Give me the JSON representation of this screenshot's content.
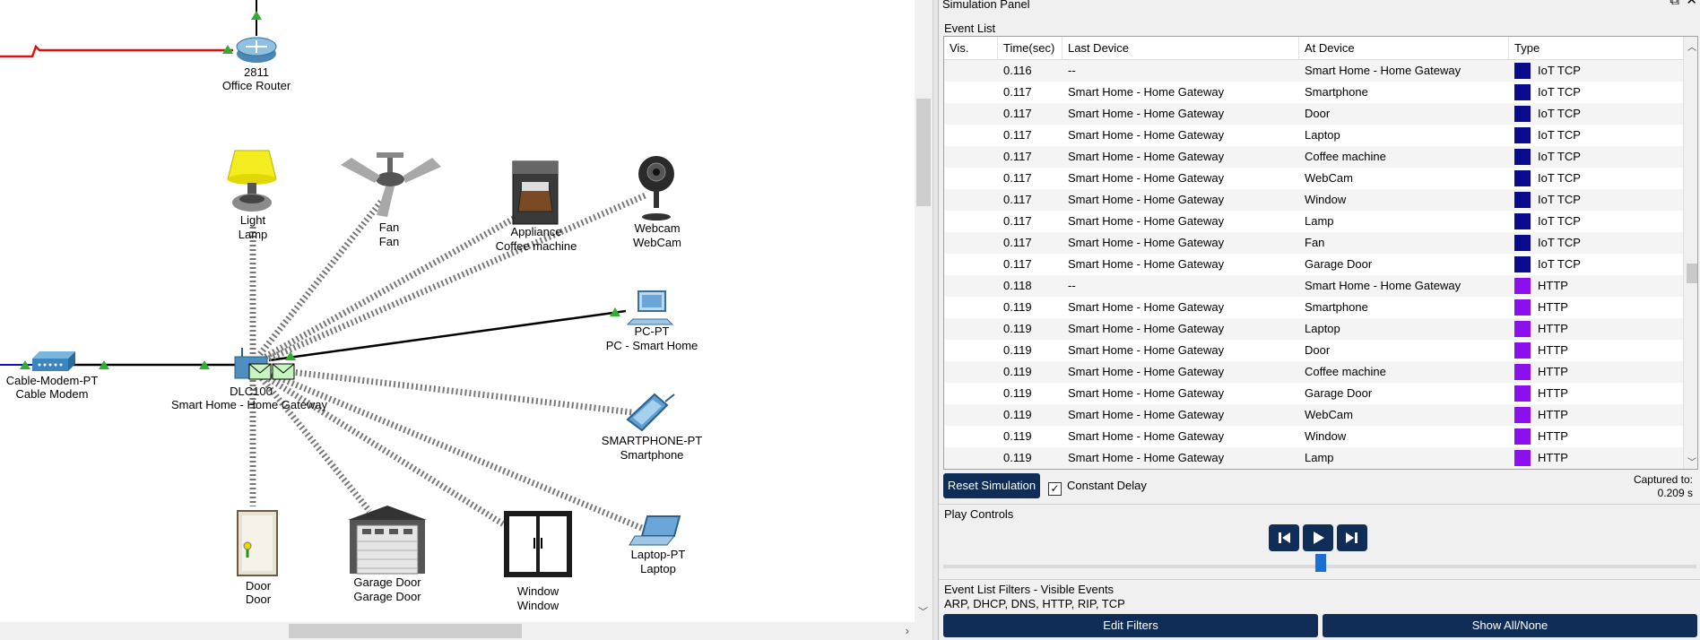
{
  "devices": {
    "office_router": {
      "model": "2811",
      "name": "Office Router"
    },
    "cable_modem": {
      "model": "Cable-Modem-PT",
      "name": "Cable Modem"
    },
    "home_gateway": {
      "model": "DLC100",
      "name": "Smart Home - Home Gateway"
    },
    "lamp": {
      "model": "Light",
      "name": "Lamp"
    },
    "fan": {
      "model": "Fan",
      "name": "Fan"
    },
    "coffee": {
      "model": "Appliance",
      "name": "Coffee machine"
    },
    "webcam": {
      "model": "Webcam",
      "name": "WebCam"
    },
    "pc": {
      "model": "PC-PT",
      "name": "PC - Smart Home"
    },
    "smartphone": {
      "model": "SMARTPHONE-PT",
      "name": "Smartphone"
    },
    "laptop": {
      "model": "Laptop-PT",
      "name": "Laptop"
    },
    "door": {
      "model": "Door",
      "name": "Door"
    },
    "garage": {
      "model": "Garage Door",
      "name": "Garage Door"
    },
    "window": {
      "model": "Window",
      "name": "Window"
    }
  },
  "panel": {
    "title": "Simulation Panel",
    "event_list_label": "Event List",
    "columns": [
      "Vis.",
      "Time(sec)",
      "Last Device",
      "At Device",
      "Type"
    ],
    "events": [
      {
        "time": "0.116",
        "last": "--",
        "at": "Smart Home - Home Gateway",
        "type": "IoT TCP",
        "color": "#0a0a8c"
      },
      {
        "time": "0.117",
        "last": "Smart Home - Home Gateway",
        "at": "Smartphone",
        "type": "IoT TCP",
        "color": "#0a0a8c"
      },
      {
        "time": "0.117",
        "last": "Smart Home - Home Gateway",
        "at": "Door",
        "type": "IoT TCP",
        "color": "#0a0a8c"
      },
      {
        "time": "0.117",
        "last": "Smart Home - Home Gateway",
        "at": "Laptop",
        "type": "IoT TCP",
        "color": "#0a0a8c"
      },
      {
        "time": "0.117",
        "last": "Smart Home - Home Gateway",
        "at": "Coffee machine",
        "type": "IoT TCP",
        "color": "#0a0a8c"
      },
      {
        "time": "0.117",
        "last": "Smart Home - Home Gateway",
        "at": "WebCam",
        "type": "IoT TCP",
        "color": "#0a0a8c"
      },
      {
        "time": "0.117",
        "last": "Smart Home - Home Gateway",
        "at": "Window",
        "type": "IoT TCP",
        "color": "#0a0a8c"
      },
      {
        "time": "0.117",
        "last": "Smart Home - Home Gateway",
        "at": "Lamp",
        "type": "IoT TCP",
        "color": "#0a0a8c"
      },
      {
        "time": "0.117",
        "last": "Smart Home - Home Gateway",
        "at": "Fan",
        "type": "IoT TCP",
        "color": "#0a0a8c"
      },
      {
        "time": "0.117",
        "last": "Smart Home - Home Gateway",
        "at": "Garage Door",
        "type": "IoT TCP",
        "color": "#0a0a8c"
      },
      {
        "time": "0.118",
        "last": "--",
        "at": "Smart Home - Home Gateway",
        "type": "HTTP",
        "color": "#8c0ff0"
      },
      {
        "time": "0.119",
        "last": "Smart Home - Home Gateway",
        "at": "Smartphone",
        "type": "HTTP",
        "color": "#8c0ff0"
      },
      {
        "time": "0.119",
        "last": "Smart Home - Home Gateway",
        "at": "Laptop",
        "type": "HTTP",
        "color": "#8c0ff0"
      },
      {
        "time": "0.119",
        "last": "Smart Home - Home Gateway",
        "at": "Door",
        "type": "HTTP",
        "color": "#8c0ff0"
      },
      {
        "time": "0.119",
        "last": "Smart Home - Home Gateway",
        "at": "Coffee machine",
        "type": "HTTP",
        "color": "#8c0ff0"
      },
      {
        "time": "0.119",
        "last": "Smart Home - Home Gateway",
        "at": "Garage Door",
        "type": "HTTP",
        "color": "#8c0ff0"
      },
      {
        "time": "0.119",
        "last": "Smart Home - Home Gateway",
        "at": "WebCam",
        "type": "HTTP",
        "color": "#8c0ff0"
      },
      {
        "time": "0.119",
        "last": "Smart Home - Home Gateway",
        "at": "Window",
        "type": "HTTP",
        "color": "#8c0ff0"
      },
      {
        "time": "0.119",
        "last": "Smart Home - Home Gateway",
        "at": "Lamp",
        "type": "HTTP",
        "color": "#8c0ff0"
      }
    ],
    "reset_label": "Reset Simulation",
    "constant_delay_label": "Constant Delay",
    "constant_delay_checked": true,
    "captured_label": "Captured to:",
    "captured_value": "0.209 s",
    "play_controls_label": "Play Controls",
    "filters_label": "Event List Filters - Visible Events",
    "filters_value": "ARP, DHCP, DNS, HTTP, RIP, TCP",
    "edit_filters_label": "Edit Filters",
    "show_all_label": "Show All/None"
  },
  "colors": {
    "navy_button": "#0f2d56",
    "iot_tcp": "#0a0a8c",
    "http": "#8c0ff0",
    "link_red": "#e01010",
    "link_green": "#2fae2f"
  }
}
